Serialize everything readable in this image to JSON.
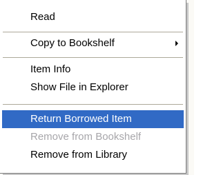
{
  "context_menu": {
    "items": [
      {
        "label": "Read"
      },
      {
        "label": "Copy to Bookshelf",
        "submenu_icon": "chevron-right-icon"
      },
      {
        "label": "Item Info"
      },
      {
        "label": "Show File in Explorer"
      },
      {
        "label": "Return Borrowed Item",
        "state": "highlighted"
      },
      {
        "label": "Remove from Bookshelf",
        "state": "disabled"
      },
      {
        "label": "Remove from Library"
      }
    ]
  },
  "colors": {
    "highlight_background": "#316ac5",
    "highlight_text": "#ffffff",
    "disabled_text": "#a7a6aa",
    "separator": "#aca899"
  }
}
